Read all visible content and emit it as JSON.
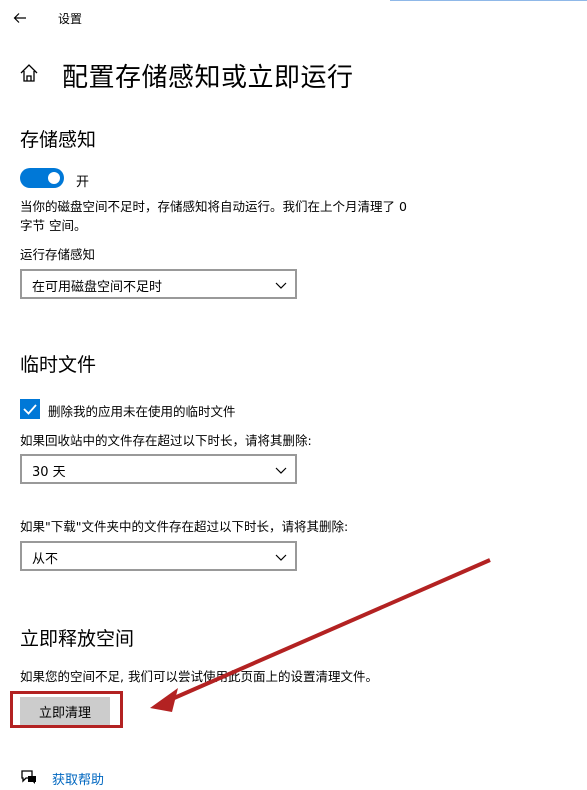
{
  "window": {
    "title": "设置"
  },
  "header": {
    "title": "配置存储感知或立即运行"
  },
  "storage_sense": {
    "heading": "存储感知",
    "toggle_label": "开",
    "description_line1": "当你的磁盘空间不足时，存储感知将自动运行。我们在上个月清理了 0",
    "description_line2": "字节 空间。",
    "run_label": "运行存储感知",
    "run_value": "在可用磁盘空间不足时"
  },
  "temp_files": {
    "heading": "临时文件",
    "checkbox_label": "删除我的应用未在使用的临时文件",
    "recycle_label": "如果回收站中的文件存在超过以下时长，请将其删除:",
    "recycle_value": "30 天",
    "downloads_label": "如果\"下载\"文件夹中的文件存在超过以下时长，请将其删除:",
    "downloads_value": "从不"
  },
  "free_space": {
    "heading": "立即释放空间",
    "description": "如果您的空间不足, 我们可以尝试使用此页面上的设置清理文件。",
    "button_label": "立即清理"
  },
  "help": {
    "label": "获取帮助"
  },
  "colors": {
    "accent": "#0078d7",
    "annotation": "#b32222",
    "link": "#0067c0"
  }
}
